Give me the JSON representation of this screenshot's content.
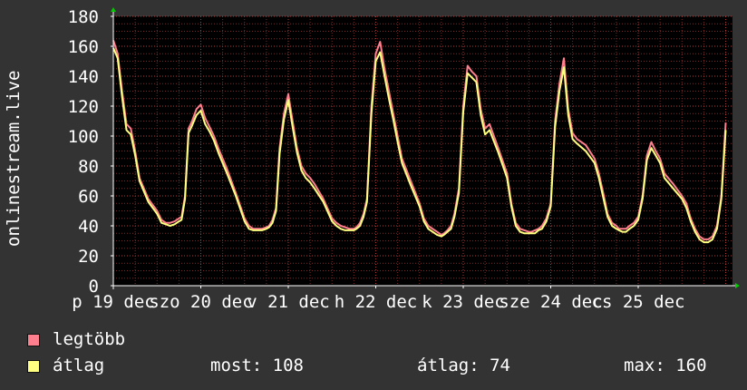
{
  "colors": {
    "background": "#333333",
    "plot_background": "#000000",
    "grid": "#7a2a2a",
    "axis": "#ffffff",
    "arrow": "#00cc00",
    "max_series": "#ff7f8f",
    "avg_series": "#ffff80"
  },
  "legend": {
    "max_label": "legtöbb",
    "avg_label": "átlag"
  },
  "stats": {
    "now": "most: 108",
    "average": "átlag: 74",
    "max": "max: 160"
  },
  "chart_data": {
    "type": "line",
    "ylabel": "onlinestream.live",
    "ylim": [
      0,
      180
    ],
    "yticks": [
      0,
      20,
      40,
      60,
      80,
      100,
      120,
      140,
      160,
      180
    ],
    "grid": true,
    "xlim": [
      0,
      7
    ],
    "xticks": [
      {
        "x": 0,
        "label": "p 19 dec"
      },
      {
        "x": 1,
        "label": "szo 20 dec"
      },
      {
        "x": 2,
        "label": "v 21 dec"
      },
      {
        "x": 3,
        "label": "h 22 dec"
      },
      {
        "x": 4,
        "label": "k 23 dec"
      },
      {
        "x": 5,
        "label": "sze 24 dec"
      },
      {
        "x": 6,
        "label": "cs 25 dec"
      }
    ],
    "series": [
      {
        "name": "legtöbb",
        "x": [
          0,
          0.05,
          0.1,
          0.15,
          0.2,
          0.25,
          0.3,
          0.4,
          0.5,
          0.55,
          0.6,
          0.65,
          0.7,
          0.75,
          0.78,
          0.82,
          0.86,
          0.9,
          0.95,
          1.0,
          1.05,
          1.1,
          1.15,
          1.2,
          1.25,
          1.3,
          1.4,
          1.5,
          1.55,
          1.6,
          1.65,
          1.7,
          1.75,
          1.78,
          1.82,
          1.86,
          1.9,
          1.95,
          2.0,
          2.05,
          2.1,
          2.15,
          2.2,
          2.25,
          2.3,
          2.4,
          2.5,
          2.55,
          2.6,
          2.65,
          2.7,
          2.75,
          2.78,
          2.82,
          2.86,
          2.9,
          2.95,
          3.0,
          3.05,
          3.1,
          3.15,
          3.2,
          3.25,
          3.3,
          3.4,
          3.5,
          3.55,
          3.6,
          3.65,
          3.7,
          3.75,
          3.78,
          3.82,
          3.86,
          3.9,
          3.95,
          4.0,
          4.05,
          4.1,
          4.15,
          4.2,
          4.25,
          4.3,
          4.4,
          4.5,
          4.55,
          4.6,
          4.65,
          4.7,
          4.75,
          4.78,
          4.82,
          4.86,
          4.9,
          4.95,
          5.0,
          5.05,
          5.1,
          5.15,
          5.2,
          5.25,
          5.3,
          5.4,
          5.5,
          5.55,
          5.6,
          5.65,
          5.7,
          5.75,
          5.78,
          5.82,
          5.86,
          5.9,
          5.95,
          6.0,
          6.05,
          6.1,
          6.15,
          6.2,
          6.25,
          6.3,
          6.4,
          6.5,
          6.55,
          6.6,
          6.65,
          6.7,
          6.75,
          6.8,
          6.85,
          6.9,
          6.95,
          7.0
        ],
        "values": [
          164,
          155,
          130,
          108,
          105,
          90,
          72,
          58,
          50,
          44,
          42,
          42,
          43,
          45,
          46,
          60,
          105,
          110,
          118,
          121,
          112,
          106,
          100,
          92,
          85,
          78,
          62,
          45,
          40,
          38,
          38,
          38,
          39,
          40,
          44,
          52,
          92,
          115,
          128,
          110,
          92,
          80,
          75,
          72,
          68,
          58,
          45,
          42,
          40,
          39,
          38,
          38,
          39,
          42,
          48,
          58,
          120,
          155,
          163,
          145,
          130,
          115,
          100,
          85,
          70,
          55,
          45,
          40,
          38,
          36,
          34,
          35,
          37,
          40,
          48,
          65,
          120,
          147,
          143,
          140,
          118,
          105,
          108,
          92,
          75,
          55,
          42,
          38,
          37,
          36,
          36,
          37,
          38,
          40,
          45,
          55,
          110,
          135,
          152,
          118,
          102,
          98,
          94,
          85,
          75,
          62,
          48,
          42,
          40,
          38,
          38,
          38,
          40,
          42,
          46,
          60,
          87,
          96,
          90,
          85,
          75,
          68,
          60,
          55,
          45,
          38,
          33,
          31,
          31,
          33,
          40,
          60,
          109
        ]
      },
      {
        "name": "átlag",
        "x": [
          0,
          0.05,
          0.1,
          0.15,
          0.2,
          0.25,
          0.3,
          0.4,
          0.5,
          0.55,
          0.6,
          0.65,
          0.7,
          0.75,
          0.78,
          0.82,
          0.86,
          0.9,
          0.95,
          1.0,
          1.05,
          1.1,
          1.15,
          1.2,
          1.25,
          1.3,
          1.4,
          1.5,
          1.55,
          1.6,
          1.65,
          1.7,
          1.75,
          1.78,
          1.82,
          1.86,
          1.9,
          1.95,
          2.0,
          2.05,
          2.1,
          2.15,
          2.2,
          2.25,
          2.3,
          2.4,
          2.5,
          2.55,
          2.6,
          2.65,
          2.7,
          2.75,
          2.78,
          2.82,
          2.86,
          2.9,
          2.95,
          3.0,
          3.05,
          3.1,
          3.15,
          3.2,
          3.25,
          3.3,
          3.4,
          3.5,
          3.55,
          3.6,
          3.65,
          3.7,
          3.75,
          3.78,
          3.82,
          3.86,
          3.9,
          3.95,
          4.0,
          4.05,
          4.1,
          4.15,
          4.2,
          4.25,
          4.3,
          4.4,
          4.5,
          4.55,
          4.6,
          4.65,
          4.7,
          4.75,
          4.78,
          4.82,
          4.86,
          4.9,
          4.95,
          5.0,
          5.05,
          5.1,
          5.15,
          5.2,
          5.25,
          5.3,
          5.4,
          5.5,
          5.55,
          5.6,
          5.65,
          5.7,
          5.75,
          5.78,
          5.82,
          5.86,
          5.9,
          5.95,
          6.0,
          6.05,
          6.1,
          6.15,
          6.2,
          6.25,
          6.3,
          6.4,
          6.5,
          6.55,
          6.6,
          6.65,
          6.7,
          6.75,
          6.8,
          6.85,
          6.9,
          6.95,
          7.0
        ],
        "values": [
          159,
          152,
          126,
          104,
          101,
          87,
          70,
          56,
          48,
          42,
          41,
          40,
          41,
          43,
          44,
          58,
          102,
          107,
          114,
          117,
          108,
          103,
          97,
          89,
          82,
          75,
          60,
          43,
          38,
          37,
          37,
          37,
          38,
          39,
          42,
          50,
          88,
          111,
          124,
          106,
          89,
          77,
          72,
          69,
          65,
          56,
          43,
          40,
          38,
          37,
          37,
          37,
          38,
          40,
          46,
          56,
          115,
          150,
          156,
          140,
          125,
          111,
          96,
          82,
          67,
          53,
          43,
          38,
          36,
          34,
          33,
          34,
          36,
          38,
          46,
          62,
          116,
          142,
          139,
          136,
          114,
          101,
          104,
          89,
          72,
          53,
          40,
          36,
          35,
          35,
          35,
          35,
          37,
          38,
          43,
          53,
          106,
          130,
          146,
          114,
          98,
          95,
          90,
          82,
          72,
          59,
          46,
          40,
          38,
          37,
          36,
          36,
          38,
          40,
          44,
          58,
          84,
          92,
          87,
          82,
          72,
          65,
          58,
          52,
          43,
          36,
          31,
          29,
          29,
          31,
          38,
          58,
          104
        ]
      }
    ]
  }
}
